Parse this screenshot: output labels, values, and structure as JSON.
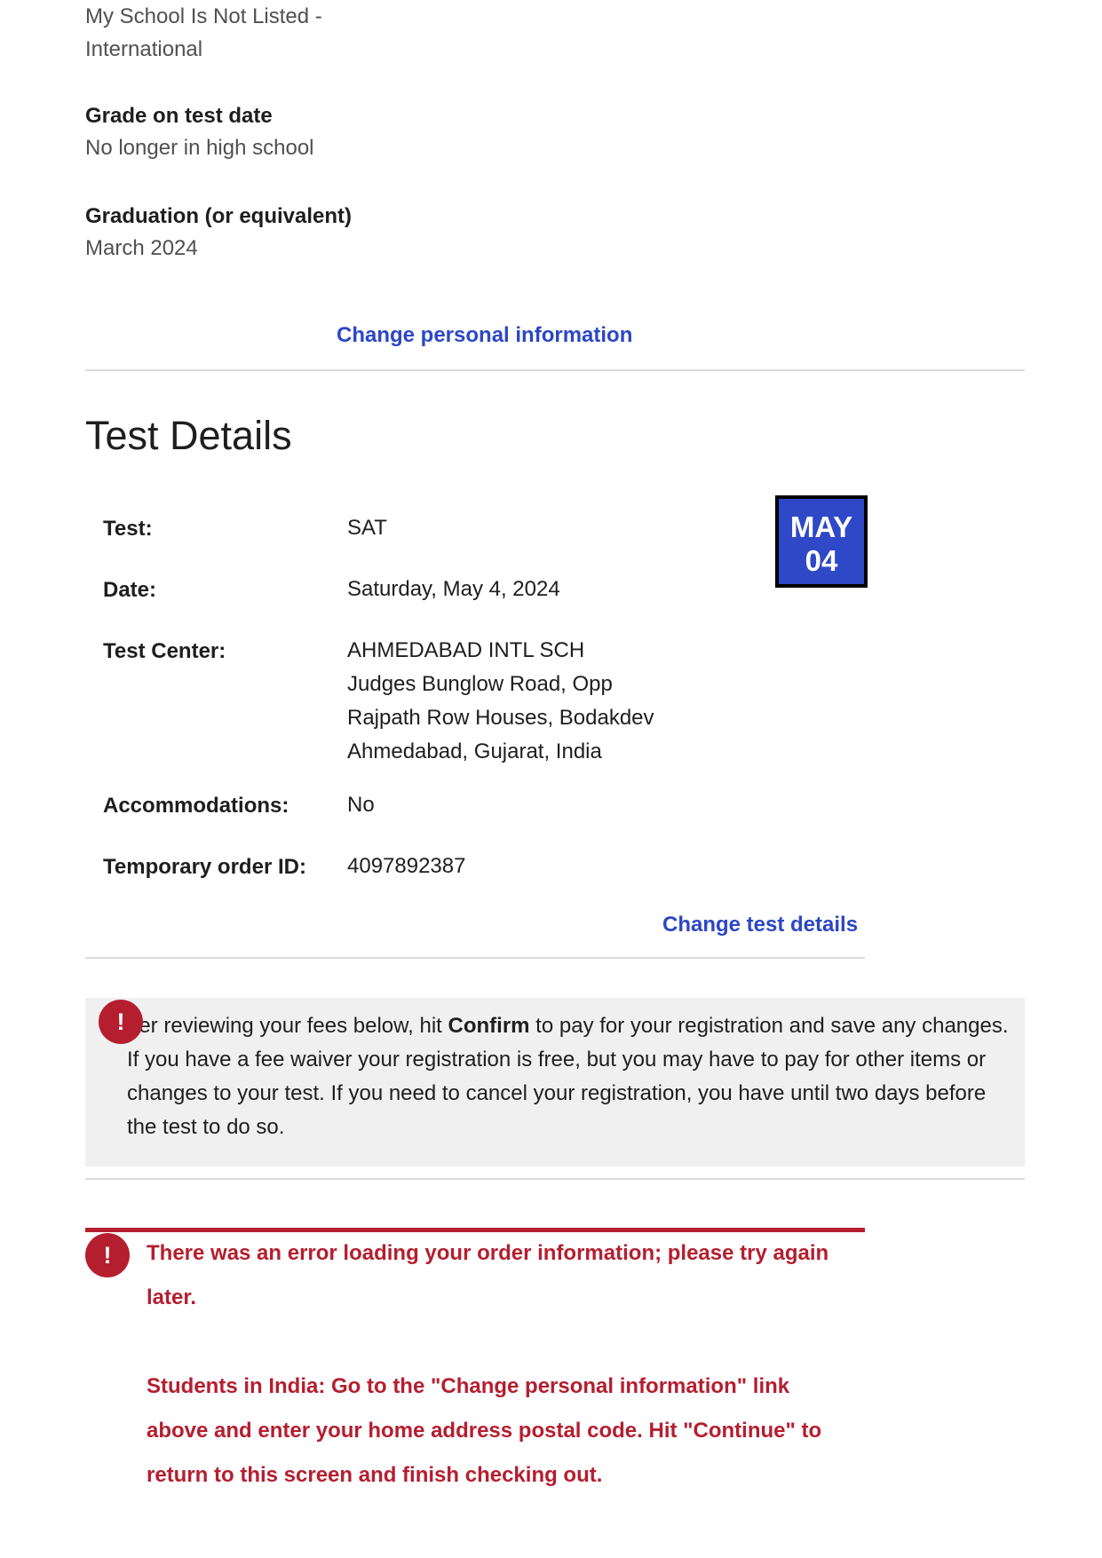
{
  "personal": {
    "school_line1": "My School Is Not Listed -",
    "school_line2": "International",
    "grade_label": "Grade on test date",
    "grade_value": "No longer in high school",
    "graduation_label": "Graduation (or equivalent)",
    "graduation_value": "March 2024",
    "change_link": "Change personal information"
  },
  "test_details": {
    "title": "Test Details",
    "badge_month": "MAY",
    "badge_day": "04",
    "rows": {
      "test": {
        "label": "Test:",
        "value": "SAT"
      },
      "date": {
        "label": "Date:",
        "value": "Saturday, May 4, 2024"
      },
      "center": {
        "label": "Test Center:",
        "lines": [
          "AHMEDABAD INTL SCH",
          "Judges Bunglow Road, Opp",
          "Rajpath Row Houses, Bodakdev",
          "Ahmedabad, Gujarat, India"
        ]
      },
      "accommodations": {
        "label": "Accommodations:",
        "value": "No"
      },
      "order": {
        "label": "Temporary order ID:",
        "value": "4097892387"
      }
    },
    "change_link": "Change test details"
  },
  "info_notice": {
    "icon": "!",
    "text_before": "fter reviewing your fees below, hit ",
    "text_bold": "Confirm",
    "text_after": " to pay for your registration and save any changes. If you have a fee waiver your registration is free, but you may have to pay for other items or changes to your test. If you need to cancel your registration, you have until two days before the test to do so."
  },
  "error_notice": {
    "icon": "!",
    "message": "There was an error loading your order information; please try again later.",
    "india_note": "Students in India: Go to the \"Change personal information\" link above and enter your home address postal code. Hit \"Continue\" to return to this screen and finish checking out."
  },
  "colors": {
    "link": "#2c47c4",
    "badge": "#2e48c7",
    "error": "#b51e2f",
    "notice_bg": "#f0f0f1"
  }
}
